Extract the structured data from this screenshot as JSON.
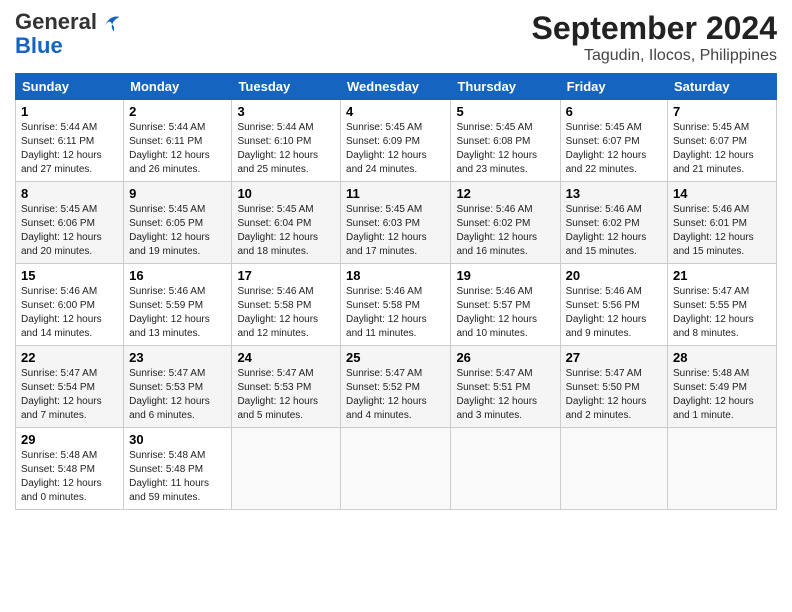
{
  "header": {
    "logo_line1": "General",
    "logo_line2": "Blue",
    "month": "September 2024",
    "location": "Tagudin, Ilocos, Philippines"
  },
  "weekdays": [
    "Sunday",
    "Monday",
    "Tuesday",
    "Wednesday",
    "Thursday",
    "Friday",
    "Saturday"
  ],
  "weeks": [
    [
      {
        "day": "1",
        "info": "Sunrise: 5:44 AM\nSunset: 6:11 PM\nDaylight: 12 hours\nand 27 minutes."
      },
      {
        "day": "2",
        "info": "Sunrise: 5:44 AM\nSunset: 6:11 PM\nDaylight: 12 hours\nand 26 minutes."
      },
      {
        "day": "3",
        "info": "Sunrise: 5:44 AM\nSunset: 6:10 PM\nDaylight: 12 hours\nand 25 minutes."
      },
      {
        "day": "4",
        "info": "Sunrise: 5:45 AM\nSunset: 6:09 PM\nDaylight: 12 hours\nand 24 minutes."
      },
      {
        "day": "5",
        "info": "Sunrise: 5:45 AM\nSunset: 6:08 PM\nDaylight: 12 hours\nand 23 minutes."
      },
      {
        "day": "6",
        "info": "Sunrise: 5:45 AM\nSunset: 6:07 PM\nDaylight: 12 hours\nand 22 minutes."
      },
      {
        "day": "7",
        "info": "Sunrise: 5:45 AM\nSunset: 6:07 PM\nDaylight: 12 hours\nand 21 minutes."
      }
    ],
    [
      {
        "day": "8",
        "info": "Sunrise: 5:45 AM\nSunset: 6:06 PM\nDaylight: 12 hours\nand 20 minutes."
      },
      {
        "day": "9",
        "info": "Sunrise: 5:45 AM\nSunset: 6:05 PM\nDaylight: 12 hours\nand 19 minutes."
      },
      {
        "day": "10",
        "info": "Sunrise: 5:45 AM\nSunset: 6:04 PM\nDaylight: 12 hours\nand 18 minutes."
      },
      {
        "day": "11",
        "info": "Sunrise: 5:45 AM\nSunset: 6:03 PM\nDaylight: 12 hours\nand 17 minutes."
      },
      {
        "day": "12",
        "info": "Sunrise: 5:46 AM\nSunset: 6:02 PM\nDaylight: 12 hours\nand 16 minutes."
      },
      {
        "day": "13",
        "info": "Sunrise: 5:46 AM\nSunset: 6:02 PM\nDaylight: 12 hours\nand 15 minutes."
      },
      {
        "day": "14",
        "info": "Sunrise: 5:46 AM\nSunset: 6:01 PM\nDaylight: 12 hours\nand 15 minutes."
      }
    ],
    [
      {
        "day": "15",
        "info": "Sunrise: 5:46 AM\nSunset: 6:00 PM\nDaylight: 12 hours\nand 14 minutes."
      },
      {
        "day": "16",
        "info": "Sunrise: 5:46 AM\nSunset: 5:59 PM\nDaylight: 12 hours\nand 13 minutes."
      },
      {
        "day": "17",
        "info": "Sunrise: 5:46 AM\nSunset: 5:58 PM\nDaylight: 12 hours\nand 12 minutes."
      },
      {
        "day": "18",
        "info": "Sunrise: 5:46 AM\nSunset: 5:58 PM\nDaylight: 12 hours\nand 11 minutes."
      },
      {
        "day": "19",
        "info": "Sunrise: 5:46 AM\nSunset: 5:57 PM\nDaylight: 12 hours\nand 10 minutes."
      },
      {
        "day": "20",
        "info": "Sunrise: 5:46 AM\nSunset: 5:56 PM\nDaylight: 12 hours\nand 9 minutes."
      },
      {
        "day": "21",
        "info": "Sunrise: 5:47 AM\nSunset: 5:55 PM\nDaylight: 12 hours\nand 8 minutes."
      }
    ],
    [
      {
        "day": "22",
        "info": "Sunrise: 5:47 AM\nSunset: 5:54 PM\nDaylight: 12 hours\nand 7 minutes."
      },
      {
        "day": "23",
        "info": "Sunrise: 5:47 AM\nSunset: 5:53 PM\nDaylight: 12 hours\nand 6 minutes."
      },
      {
        "day": "24",
        "info": "Sunrise: 5:47 AM\nSunset: 5:53 PM\nDaylight: 12 hours\nand 5 minutes."
      },
      {
        "day": "25",
        "info": "Sunrise: 5:47 AM\nSunset: 5:52 PM\nDaylight: 12 hours\nand 4 minutes."
      },
      {
        "day": "26",
        "info": "Sunrise: 5:47 AM\nSunset: 5:51 PM\nDaylight: 12 hours\nand 3 minutes."
      },
      {
        "day": "27",
        "info": "Sunrise: 5:47 AM\nSunset: 5:50 PM\nDaylight: 12 hours\nand 2 minutes."
      },
      {
        "day": "28",
        "info": "Sunrise: 5:48 AM\nSunset: 5:49 PM\nDaylight: 12 hours\nand 1 minute."
      }
    ],
    [
      {
        "day": "29",
        "info": "Sunrise: 5:48 AM\nSunset: 5:48 PM\nDaylight: 12 hours\nand 0 minutes."
      },
      {
        "day": "30",
        "info": "Sunrise: 5:48 AM\nSunset: 5:48 PM\nDaylight: 11 hours\nand 59 minutes."
      },
      {
        "day": "",
        "info": ""
      },
      {
        "day": "",
        "info": ""
      },
      {
        "day": "",
        "info": ""
      },
      {
        "day": "",
        "info": ""
      },
      {
        "day": "",
        "info": ""
      }
    ]
  ]
}
